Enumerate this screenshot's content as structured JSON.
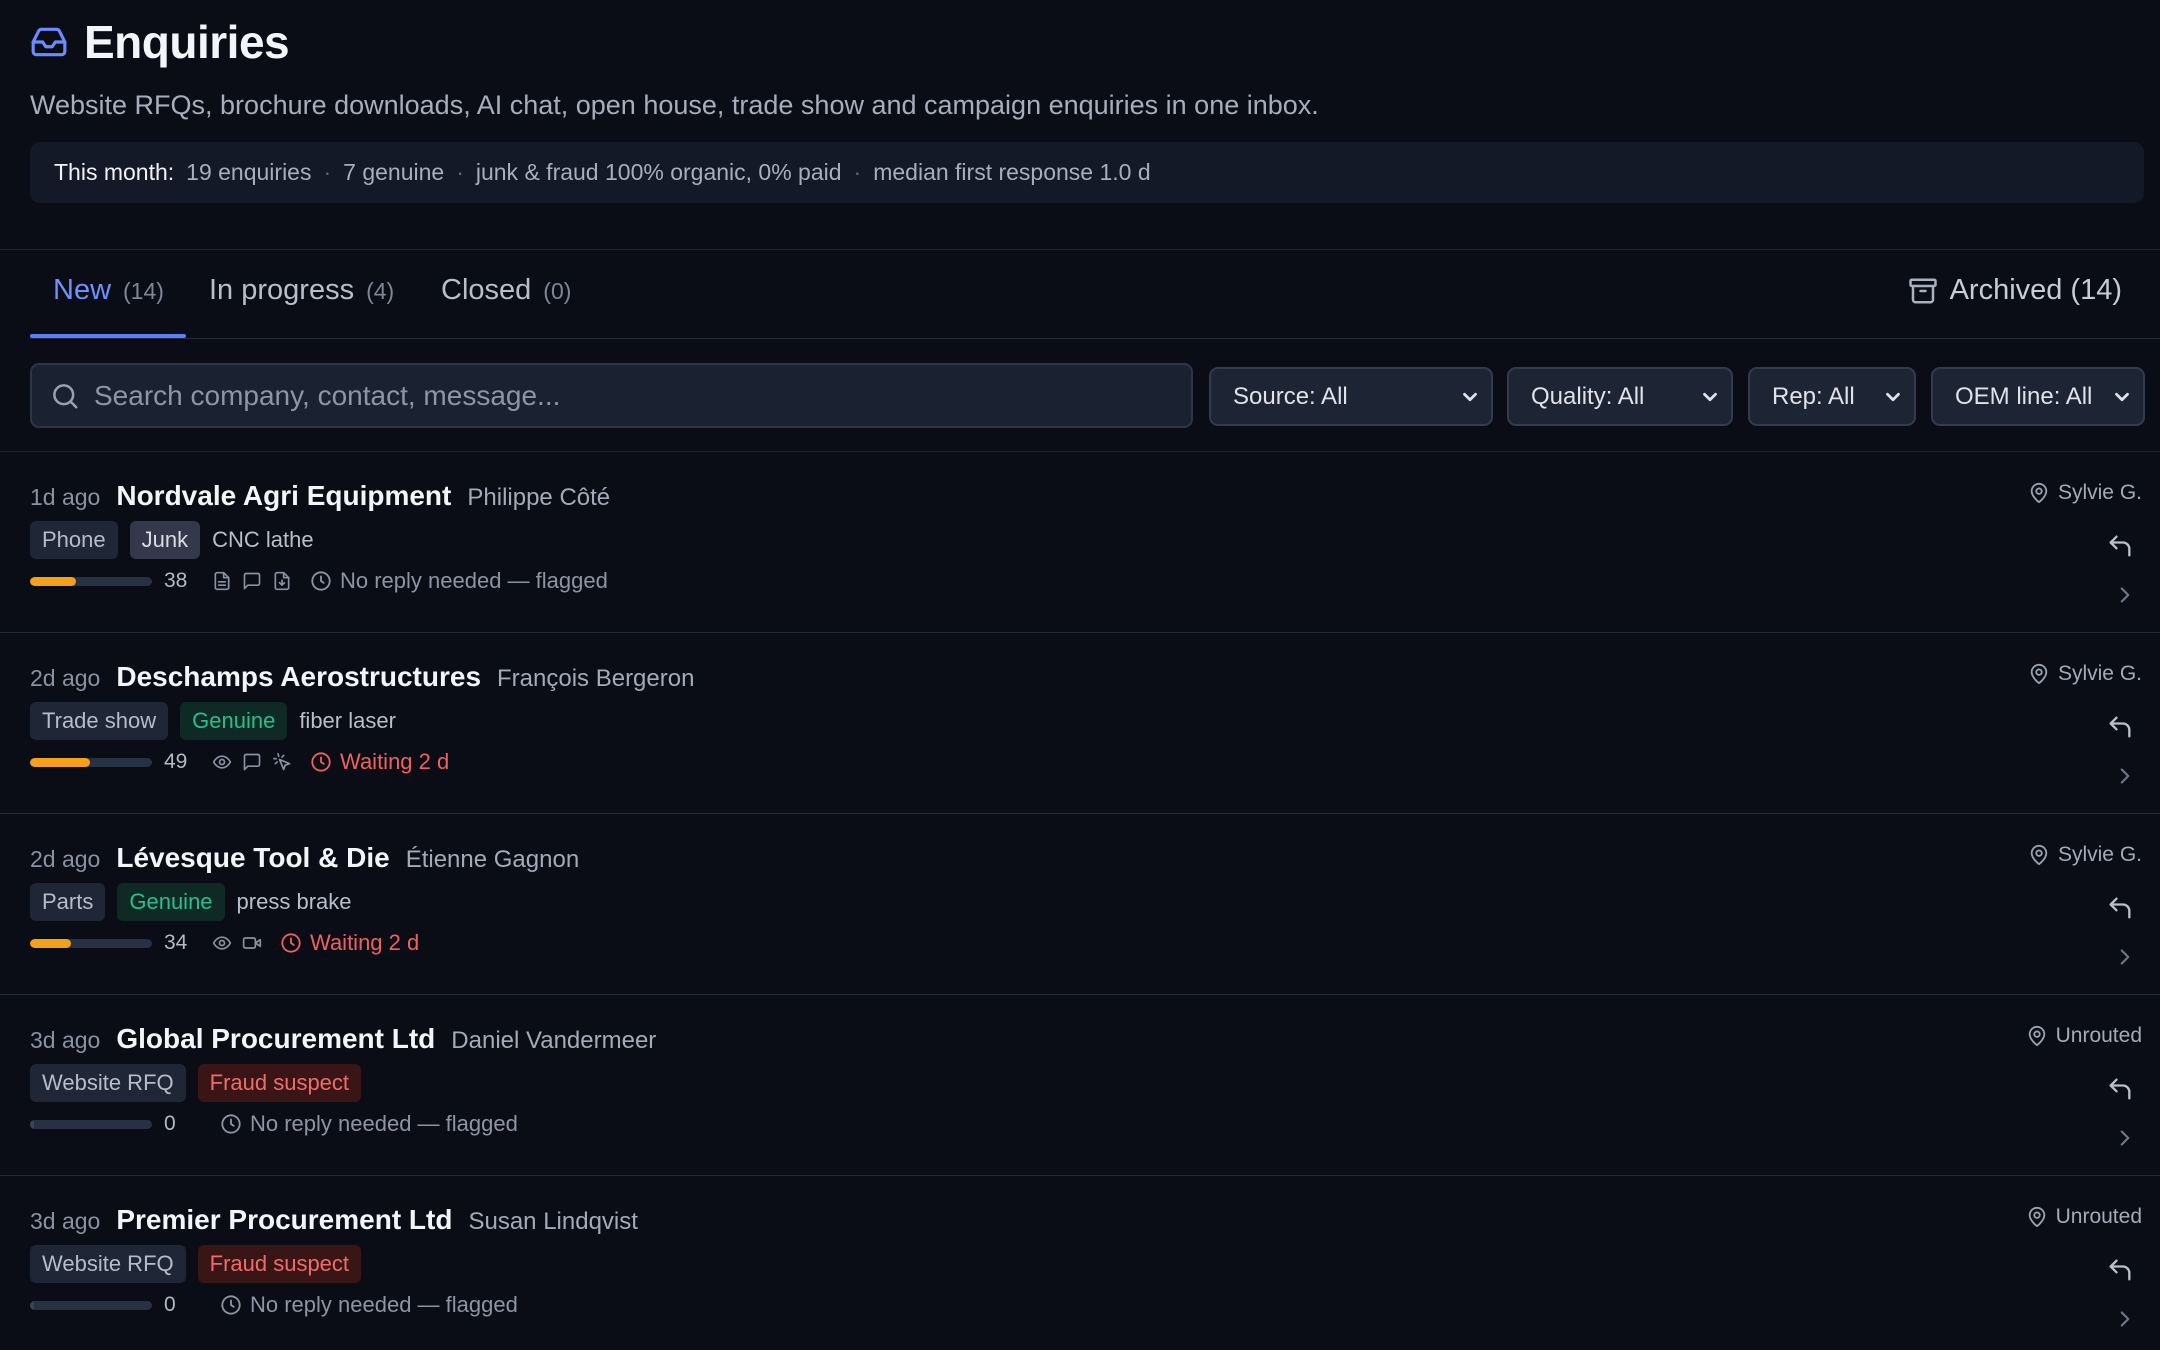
{
  "header": {
    "title": "Enquiries",
    "title_icon": "inbox-icon",
    "subtitle": "Website RFQs, brochure downloads, AI chat, open house, trade show and campaign enquiries in one inbox."
  },
  "summary": {
    "label": "This month:",
    "enquiries": "19 enquiries",
    "genuine": "7 genuine",
    "junk": "junk & fraud 100% organic, 0% paid",
    "response": "median first response 1.0 d"
  },
  "tabs": [
    {
      "label": "New",
      "count": "(14)",
      "active": true
    },
    {
      "label": "In progress",
      "count": "(4)",
      "active": false
    },
    {
      "label": "Closed",
      "count": "(0)",
      "active": false
    }
  ],
  "archived": {
    "label": "Archived",
    "count": "(14)",
    "icon": "archive-icon"
  },
  "search": {
    "placeholder": "Search company, contact, message...",
    "value": ""
  },
  "filters": {
    "source": "Source: All",
    "quality": "Quality: All",
    "rep": "Rep: All",
    "oem": "OEM line: All"
  },
  "colors": {
    "accent": "#5b7dff",
    "score_bar": "#f5a01a",
    "genuine": "#27c08a",
    "fraud": "#f06b6b",
    "waiting": "#f0605c"
  },
  "enquiries": [
    {
      "age": "1d ago",
      "company": "Nordvale Agri Equipment",
      "contact": "Philippe Côté",
      "source": "Phone",
      "quality": "Junk",
      "product": "CNC lathe",
      "score": "38",
      "score_fraction": 0.38,
      "activity_icons": [
        "document-icon",
        "chat-icon",
        "download-icon"
      ],
      "status": "No reply needed — flagged",
      "rep": "Sylvie G."
    },
    {
      "age": "2d ago",
      "company": "Deschamps Aerostructures",
      "contact": "François Bergeron",
      "source": "Trade show",
      "quality": "Genuine",
      "product": "fiber laser",
      "score": "49",
      "score_fraction": 0.49,
      "activity_icons": [
        "eye-icon",
        "chat-icon",
        "click-icon"
      ],
      "status": "Waiting 2 d",
      "rep": "Sylvie G."
    },
    {
      "age": "2d ago",
      "company": "Lévesque Tool & Die",
      "contact": "Étienne Gagnon",
      "source": "Parts",
      "quality": "Genuine",
      "product": "press brake",
      "score": "34",
      "score_fraction": 0.34,
      "activity_icons": [
        "eye-icon",
        "video-icon"
      ],
      "status": "Waiting 2 d",
      "rep": "Sylvie G."
    },
    {
      "age": "3d ago",
      "company": "Global Procurement Ltd",
      "contact": "Daniel Vandermeer",
      "source": "Website RFQ",
      "quality": "Fraud suspect",
      "product": "",
      "score": "0",
      "score_fraction": 0,
      "activity_icons": [],
      "status": "No reply needed — flagged",
      "rep": "Unrouted"
    },
    {
      "age": "3d ago",
      "company": "Premier Procurement Ltd",
      "contact": "Susan Lindqvist",
      "source": "Website RFQ",
      "quality": "Fraud suspect",
      "product": "",
      "score": "0",
      "score_fraction": 0,
      "activity_icons": [],
      "status": "No reply needed — flagged",
      "rep": "Unrouted"
    }
  ]
}
